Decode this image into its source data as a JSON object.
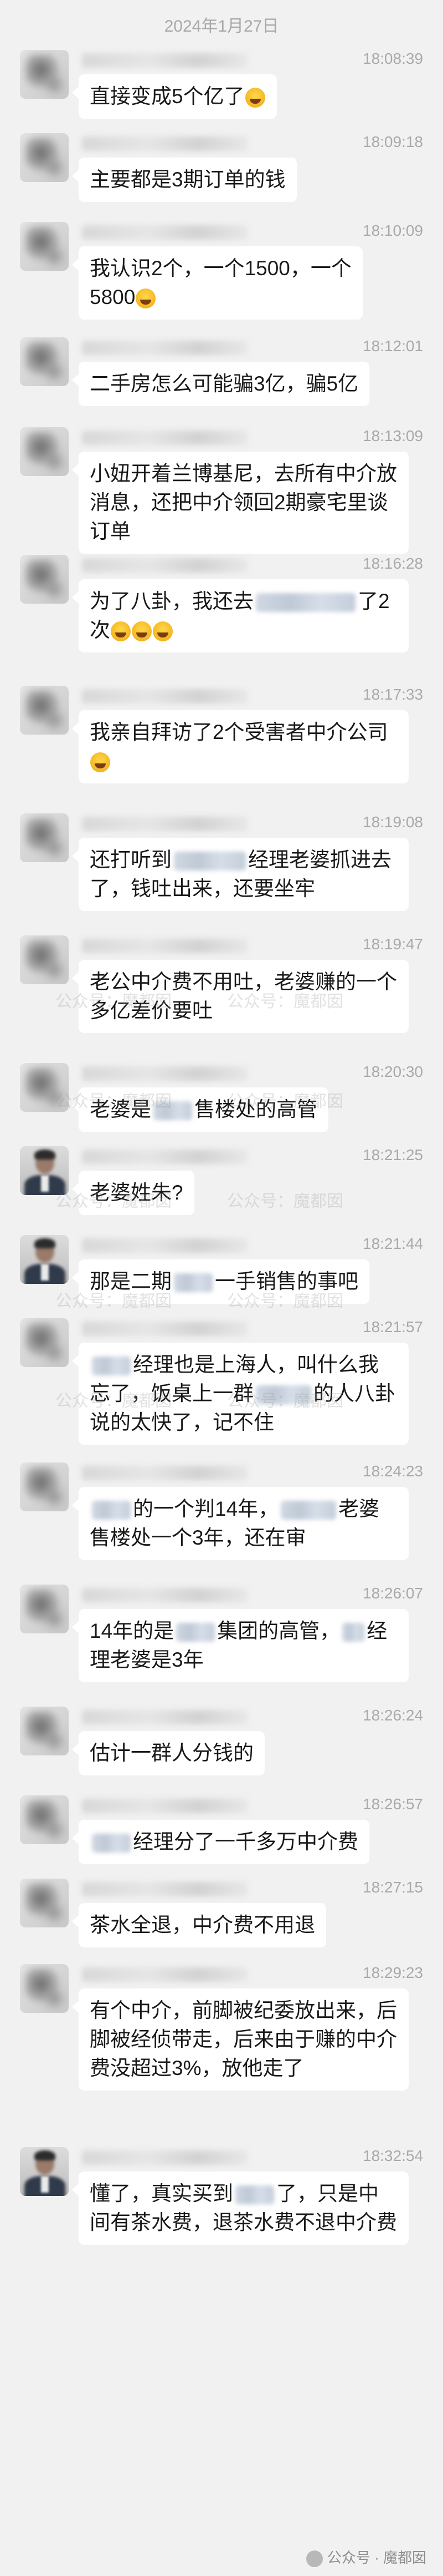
{
  "date_header": "2024年1月27日",
  "messages": [
    {
      "time": "18:08:39",
      "avatar": "blurred",
      "parts": [
        [
          "t",
          "直接变成5个亿了"
        ],
        [
          "e",
          "laugh-cry"
        ]
      ]
    },
    {
      "time": "18:09:18",
      "avatar": "blurred",
      "parts": [
        [
          "t",
          "主要都是3期订单的钱"
        ]
      ]
    },
    {
      "time": "18:10:09",
      "avatar": "blurred",
      "parts": [
        [
          "t",
          "我认识2个，一个1500，一个"
        ],
        [
          "b"
        ],
        [
          "t",
          "5800"
        ],
        [
          "e",
          "laugh-cry"
        ]
      ]
    },
    {
      "time": "18:12:01",
      "avatar": "blurred",
      "parts": [
        [
          "t",
          "二手房怎么可能骗3亿，骗5亿"
        ]
      ]
    },
    {
      "time": "18:13:09",
      "avatar": "blurred",
      "parts": [
        [
          "t",
          "小妞开着兰博基尼，去所有中介放消息，还把中介领回2期豪宅里谈订单"
        ]
      ]
    },
    {
      "time": "18:16:28",
      "avatar": "blurred",
      "parts": [
        [
          "t",
          "为了八卦，我还去"
        ],
        [
          "r",
          180
        ],
        [
          "t",
          "了2次"
        ],
        [
          "e",
          "laugh-cry"
        ],
        [
          "e",
          "laugh-cry"
        ],
        [
          "e",
          "laugh-cry"
        ]
      ]
    },
    {
      "time": "18:17:33",
      "avatar": "blurred",
      "parts": [
        [
          "t",
          "我亲自拜访了2个受害者中介公司"
        ],
        [
          "e",
          "laugh-cry"
        ]
      ]
    },
    {
      "time": "18:19:08",
      "avatar": "blurred",
      "parts": [
        [
          "t",
          "还打听到"
        ],
        [
          "r",
          130
        ],
        [
          "t",
          "经理老婆抓进去了，钱吐出来，还要坐牢"
        ]
      ]
    },
    {
      "time": "18:19:47",
      "avatar": "blurred",
      "parts": [
        [
          "t",
          "老公中介费不用吐，老婆赚的一个多亿差价要吐"
        ]
      ]
    },
    {
      "time": "18:20:30",
      "avatar": "blurred",
      "parts": [
        [
          "t",
          "老婆是"
        ],
        [
          "r",
          70
        ],
        [
          "t",
          "售楼处的高管"
        ]
      ]
    },
    {
      "time": "18:21:25",
      "avatar": "person",
      "parts": [
        [
          "t",
          "老婆姓朱?"
        ]
      ]
    },
    {
      "time": "18:21:44",
      "avatar": "person",
      "parts": [
        [
          "t",
          "那是二期"
        ],
        [
          "r",
          70
        ],
        [
          "t",
          "一手销售的事吧"
        ]
      ]
    },
    {
      "time": "18:21:57",
      "avatar": "blurred",
      "parts": [
        [
          "r",
          70
        ],
        [
          "t",
          "经理也是上海人，叫什么我忘了，饭桌上一群"
        ],
        [
          "r",
          100
        ],
        [
          "t",
          "的人八卦说的太快了，记不住"
        ]
      ]
    },
    {
      "time": "18:24:23",
      "avatar": "blurred",
      "parts": [
        [
          "r",
          70
        ],
        [
          "t",
          "的一个判14年，"
        ],
        [
          "r",
          100
        ],
        [
          "t",
          "老婆售楼处一个3年，还在审"
        ]
      ]
    },
    {
      "time": "18:26:07",
      "avatar": "blurred",
      "parts": [
        [
          "t",
          "14年的是"
        ],
        [
          "r",
          70
        ],
        [
          "t",
          "集团的高管，"
        ],
        [
          "r",
          40
        ],
        [
          "t",
          "经理老婆是3年"
        ]
      ]
    },
    {
      "time": "18:26:24",
      "avatar": "blurred",
      "parts": [
        [
          "t",
          "估计一群人分钱的"
        ]
      ]
    },
    {
      "time": "18:26:57",
      "avatar": "blurred",
      "parts": [
        [
          "r",
          70
        ],
        [
          "t",
          "经理分了一千多万中介费"
        ]
      ]
    },
    {
      "time": "18:27:15",
      "avatar": "blurred",
      "parts": [
        [
          "t",
          "茶水全退，中介费不用退"
        ]
      ]
    },
    {
      "time": "18:29:23",
      "avatar": "blurred",
      "parts": [
        [
          "t",
          "有个中介，前脚被纪委放出来，后脚被经侦带走，后来由于赚的中介费没超过3%，放他走了"
        ]
      ]
    },
    {
      "time": "18:32:54",
      "avatar": "person",
      "parts": [
        [
          "t",
          "懂了，真实买到"
        ],
        [
          "r",
          70
        ],
        [
          "t",
          "了，只是中间有茶水费，退茶水费不退中介费"
        ]
      ]
    }
  ],
  "watermark_text": "公众号：魔都囡",
  "footer_watermark": "公众号 · 魔都囡"
}
